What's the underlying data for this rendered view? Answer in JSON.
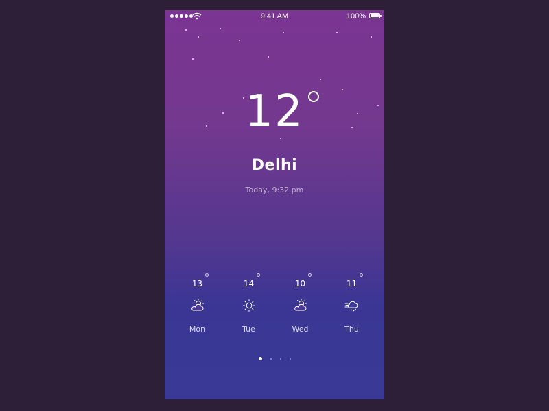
{
  "status_bar": {
    "time": "9:41 AM",
    "battery": "100%",
    "icons": [
      "signal-dots-icon",
      "wifi-icon",
      "battery-icon"
    ]
  },
  "current": {
    "temperature": "12",
    "city": "Delhi",
    "updated": "Today, 9:32 pm"
  },
  "forecast": [
    {
      "temp": "13",
      "day": "Mon",
      "icon": "partly-cloudy-icon"
    },
    {
      "temp": "14",
      "day": "Tue",
      "icon": "sun-icon"
    },
    {
      "temp": "10",
      "day": "Wed",
      "icon": "partly-cloudy-icon"
    },
    {
      "temp": "11",
      "day": "Thu",
      "icon": "cloud-rain-icon"
    }
  ],
  "pager": {
    "page_count": 4,
    "active_page": 1
  },
  "colors": {
    "background": "#2d1f38",
    "gradient_top": "#7b3592",
    "gradient_bottom": "#3a3a96",
    "text": "#ffffff"
  }
}
